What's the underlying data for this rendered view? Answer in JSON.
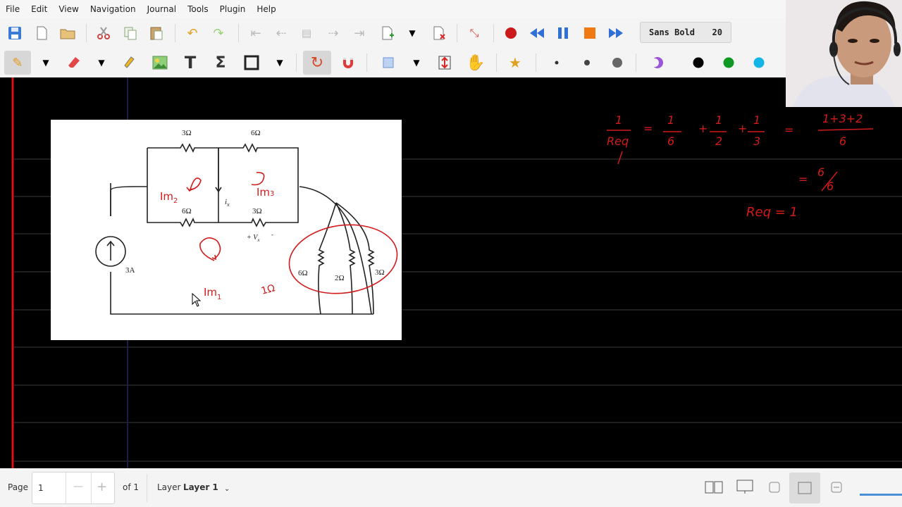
{
  "menu": [
    "File",
    "Edit",
    "View",
    "Navigation",
    "Journal",
    "Tools",
    "Plugin",
    "Help"
  ],
  "font": {
    "name": "Sans Bold",
    "size": "20"
  },
  "colors": {
    "ink": "#d21a1a",
    "canvas": "#000000",
    "page": "#ffffff"
  },
  "toolbar1_icons": [
    "save-icon",
    "new-page-icon",
    "open-icon",
    "cut-icon",
    "copy-icon",
    "paste-icon",
    "undo-icon",
    "redo-icon",
    "first-page-icon",
    "prev-page-icon",
    "page-icon",
    "next-page-icon",
    "last-page-icon",
    "add-page-icon",
    "dropdown-icon",
    "delete-page-icon",
    "fullscreen-icon",
    "record-icon",
    "rewind-icon",
    "pause-icon",
    "stop-icon",
    "fast-forward-icon"
  ],
  "toolbar2_icons": [
    "pen-icon",
    "dropdown-icon",
    "eraser-icon",
    "dropdown-icon",
    "highlighter-icon",
    "image-icon",
    "text-icon",
    "math-icon",
    "shape-icon",
    "dropdown-icon",
    "rotate-icon",
    "magnet-icon",
    "select-rect-icon",
    "dropdown-icon",
    "vertical-space-icon",
    "hand-icon",
    "favorite-icon",
    "dot-small-icon",
    "dot-medium-icon",
    "dot-large-icon",
    "color-custom-icon",
    "color-black-icon",
    "color-green-icon",
    "color-cyan-icon"
  ],
  "circuit": {
    "labels": {
      "r_top_left": "3Ω",
      "r_top_right": "6Ω",
      "r_mid_left": "6Ω",
      "r_mid_right": "3Ω",
      "current_ix": "i",
      "current_ix_sub": "x",
      "voltage_vx": "+ V",
      "voltage_vx_sub": "x",
      "vx_minus": "-",
      "source": "3A",
      "p1": "6Ω",
      "p2": "2Ω",
      "p3": "3Ω"
    },
    "annotations": {
      "mesh2": "Im",
      "mesh2_sub": "2",
      "mesh3": "Im",
      "mesh3_sub": "3",
      "mesh1": "Im",
      "mesh1_sub": "1",
      "req_label": "1Ω"
    }
  },
  "math": {
    "one_a": "1",
    "req_a": "Req",
    "eq1": "=",
    "one_b": "1",
    "six_b": "6",
    "plus1": "+",
    "one_c": "1",
    "two_c": "2",
    "plus2": "+",
    "one_d": "1",
    "three_d": "3",
    "eq2": "=",
    "num_e": "1+3+2",
    "den_e": "6",
    "eq3": "=",
    "six_f": "6",
    "six_g": "6",
    "result": "Req = 1"
  },
  "status": {
    "page_label": "Page",
    "page_value": "1",
    "minus": "—",
    "plus": "+",
    "of_label": "of 1",
    "layer_label": "Layer",
    "layer_value": "Layer 1"
  }
}
